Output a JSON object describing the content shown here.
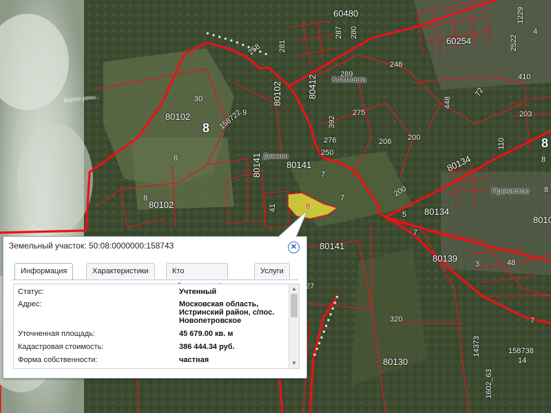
{
  "map": {
    "block_labels": [
      "80102",
      "80102",
      "80102",
      "80141",
      "80141",
      "80141",
      "80412",
      "60480",
      "60254",
      "80134",
      "80134",
      "80139",
      "80130",
      "8010"
    ],
    "parcel_numbers": [
      "30",
      "8",
      "158722",
      "9",
      "8",
      "7",
      "7",
      "7",
      "5",
      "7",
      "250",
      "276",
      "275",
      "206",
      "200",
      "392",
      "248",
      "289",
      "287",
      "280",
      "281",
      "258",
      "410",
      "203",
      "110",
      "72",
      "448",
      "200",
      "41",
      "27",
      "320",
      "14373",
      "1602_63",
      "158738",
      "14",
      "48",
      "8",
      "1229",
      "2522",
      "4",
      "3",
      "8"
    ],
    "zone_numbers": [
      "8",
      "8"
    ],
    "place_names": [
      "Климовка",
      "Пречистое",
      "Дюжкин"
    ],
    "road_name": "Берег реки..",
    "selected_parcel_label": "8"
  },
  "popup": {
    "title": "Земельный участок: 50:08:0000000:158743",
    "close_icon": "close-icon",
    "tabs": [
      {
        "label": "Информация",
        "active": true
      },
      {
        "label": "Характеристики",
        "active": false
      },
      {
        "label": "Кто обслуживает?",
        "active": false
      },
      {
        "label": "Услуги",
        "active": false
      }
    ],
    "fields": [
      {
        "label": "Статус:",
        "value": "Учтенный"
      },
      {
        "label": "Адрес:",
        "value": "Московская область,\nИстринский район, с/пос.\nНовопетровское"
      },
      {
        "label": "Уточненная площадь:",
        "value": "45 679.00 кв. м"
      },
      {
        "label": "Кадастровая стоимость:",
        "value": "386 444.34 руб."
      },
      {
        "label": "Форма собственности:",
        "value": "частная"
      }
    ]
  },
  "colors": {
    "boundary": "#e8121c",
    "selection": "#d8d43a",
    "clouds": "#c8cfc4"
  }
}
